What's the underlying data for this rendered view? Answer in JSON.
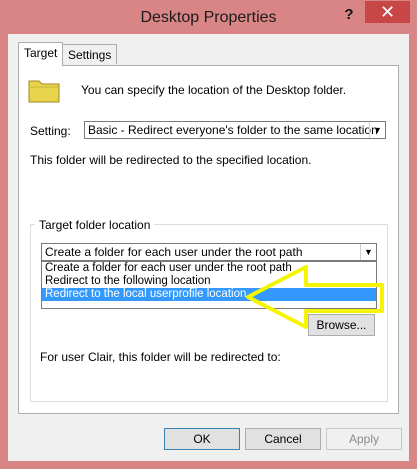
{
  "window": {
    "title": "Desktop Properties",
    "help_glyph": "?",
    "close_glyph": "✕"
  },
  "tabs": [
    {
      "label": "Target",
      "active": true
    },
    {
      "label": "Settings",
      "active": false
    }
  ],
  "target": {
    "intro_text": "You can specify the location of the Desktop folder.",
    "setting_label": "Setting:",
    "setting_value": "Basic - Redirect everyone's folder to the same location",
    "redirect_note": "This folder will be redirected to the specified location.",
    "group_title": "Target folder location",
    "location_value": "Create a folder for each user under the root path",
    "location_options": [
      "Create a folder for each user under the root path",
      "Redirect to the following location",
      "Redirect to the local userprofile location"
    ],
    "selected_option_index": 2,
    "browse_label": "Browse...",
    "preview_label": "For user Clair, this folder will be redirected to:",
    "preview_path": ""
  },
  "footer": {
    "ok_label": "OK",
    "cancel_label": "Cancel",
    "apply_label": "Apply"
  },
  "colors": {
    "title_bar": "#d98586",
    "close_button": "#c74646",
    "selection": "#3399ff",
    "annotation_arrow": "#f5f500"
  },
  "icons": {
    "folder": "folder-icon",
    "dropdown": "chevron-down-icon",
    "annotation": "arrow-left-icon"
  }
}
